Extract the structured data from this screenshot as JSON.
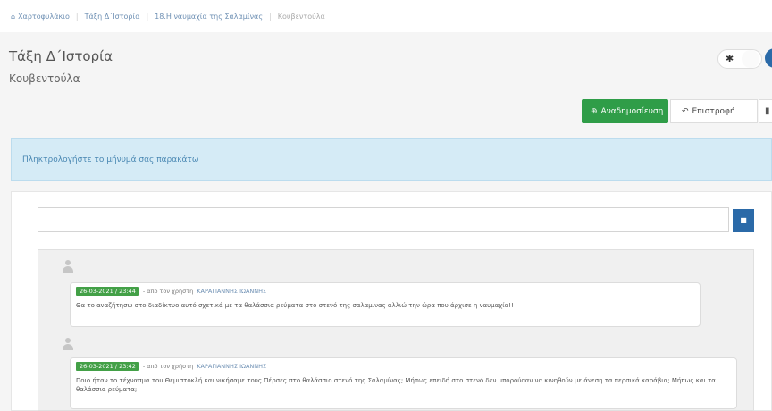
{
  "breadcrumb": {
    "items": [
      "Χαρτοφυλάκιο",
      "Τάξη Δ΄Ιστορία",
      "18.Η ναυμαχία της Σαλαμίνας",
      "Κουβεντούλα"
    ]
  },
  "page": {
    "title": "Τάξη Δ΄Ιστορία",
    "subtitle": "Κουβεντούλα"
  },
  "toolbar": {
    "publish_label": "Αναδημοσίευση",
    "back_label": "Επιστροφή"
  },
  "alert": {
    "text": "Πληκτρολογήστε το μήνυμά σας παρακάτω"
  },
  "composer": {
    "placeholder": "",
    "send_icon": "send-icon"
  },
  "messages": [
    {
      "date": "26-03-2021 / 23:44",
      "by": "- από τον χρήστη",
      "author": "ΚΑΡΑΓΙΑΝΝΗΣ ΙΩΑΝΝΗΣ",
      "text": "Θα το αναζήτησω στο διαδίκτυο αυτό σχετικά με τα θαλάσσια ρεύματα στο στενό της σαλαμινας αλλιώ την ώρα που άρχισε η ναυμαχία!!"
    },
    {
      "date": "26-03-2021 / 23:42",
      "by": "- από τον χρήστη",
      "author": "ΚΑΡΑΓΙΑΝΝΗΣ ΙΩΑΝΝΗΣ",
      "text": "Ποιο ήταν το τέχνασμα του Θεμιστοκλή και νικήσαμε τους Πέρσες στο θαλάσσιο στενό της Σαλαμίνας; Μήπως επειδή στο στενό δεν μπορούσαν να κινηθούν με άνεση τα περσικά καράβια; Μήπως και τα θαλάσσια ρεύματα;"
    }
  ],
  "colors": {
    "accent": "#2b6aa8",
    "publish": "#2f9d48",
    "alert_bg": "#d5ebf6",
    "date_badge": "#43a047"
  }
}
